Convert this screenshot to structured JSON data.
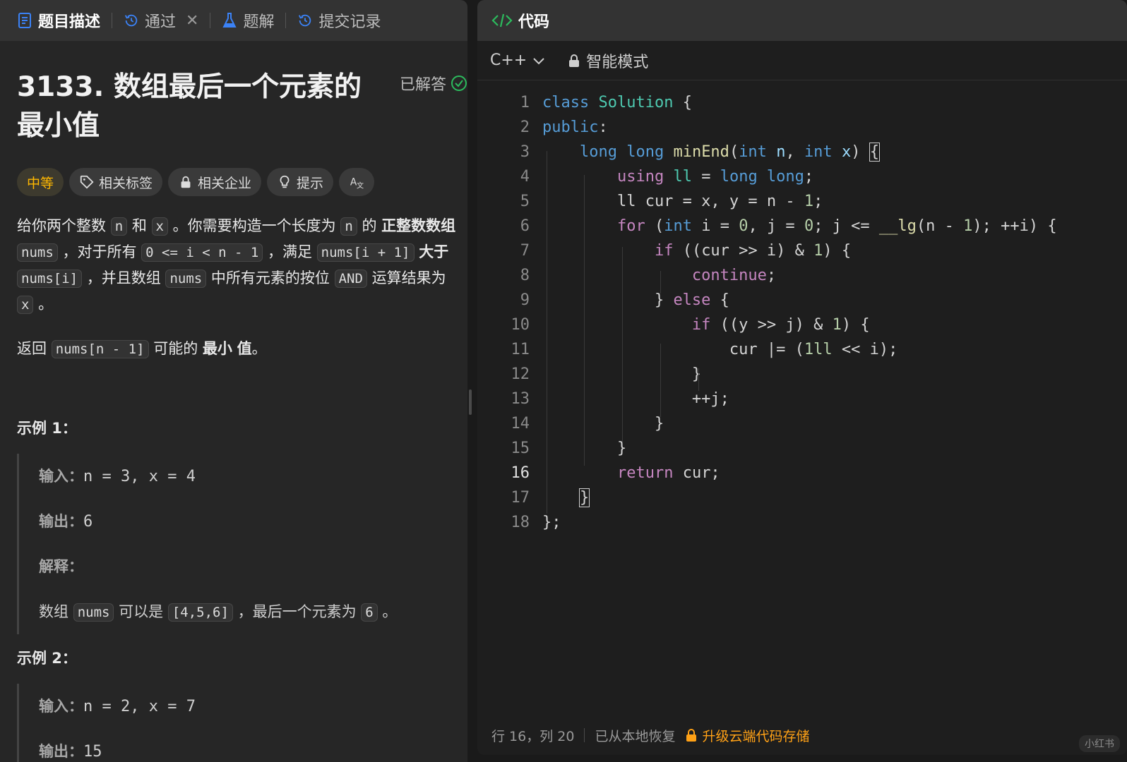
{
  "left_tabs": {
    "description": "题目描述",
    "passed": "通过",
    "solutions": "题解",
    "submissions": "提交记录"
  },
  "problem": {
    "title": "3133. 数组最后一个元素的最小值",
    "status": "已解答",
    "difficulty": "中等",
    "tags": [
      "相关标签",
      "相关企业",
      "提示",
      "A文"
    ]
  },
  "description": {
    "p1": {
      "t1": "给你两个整数",
      "c1": "n",
      "t2": "和",
      "c2": "x",
      "t3": "。你需要构造一个长度为",
      "c3": "n",
      "t4": "的",
      "b1": "正整数数组",
      "c4": "nums",
      "t5": "，对于所有",
      "c5": "0 <= i < n - 1",
      "t6": "，满足",
      "c6": "nums[i + 1]",
      "b2": "大于",
      "c7": "nums[i]",
      "t7": "，并且数组",
      "c8": "nums",
      "t8": "中所有元素的按位",
      "c9": "AND",
      "t9": "运算结果为",
      "c10": "x",
      "t10": "。"
    },
    "p2": {
      "t1": "返回",
      "c1": "nums[n - 1]",
      "t2": "可能的",
      "b1": "最小",
      "b2": "值",
      "t3": "。"
    }
  },
  "example1": {
    "title": "示例 1：",
    "input_label": "输入：",
    "input_value": "n = 3, x = 4",
    "output_label": "输出：",
    "output_value": "6",
    "explain_label": "解释：",
    "explain_t1": "数组",
    "explain_c1": "nums",
    "explain_t2": "可以是",
    "explain_c2": "[4,5,6]",
    "explain_t3": "，最后一个元素为",
    "explain_c3": "6",
    "explain_t4": "。"
  },
  "example2": {
    "title": "示例 2：",
    "input_label": "输入：",
    "input_value": "n = 2, x = 7",
    "output_label": "输出：",
    "output_value": "15"
  },
  "editor": {
    "panel_title": "代码",
    "language": "C++",
    "mode": "智能模式",
    "current_line": 16
  },
  "status_bar": {
    "cursor": "行 16，列 20",
    "restored": "已从本地恢复",
    "upgrade": "升级云端代码存储"
  },
  "watermark": "小红书",
  "colors": {
    "accent_orange": "#ffa116",
    "difficulty_medium": "#ffb800",
    "solved_green": "#2cbb5d"
  }
}
